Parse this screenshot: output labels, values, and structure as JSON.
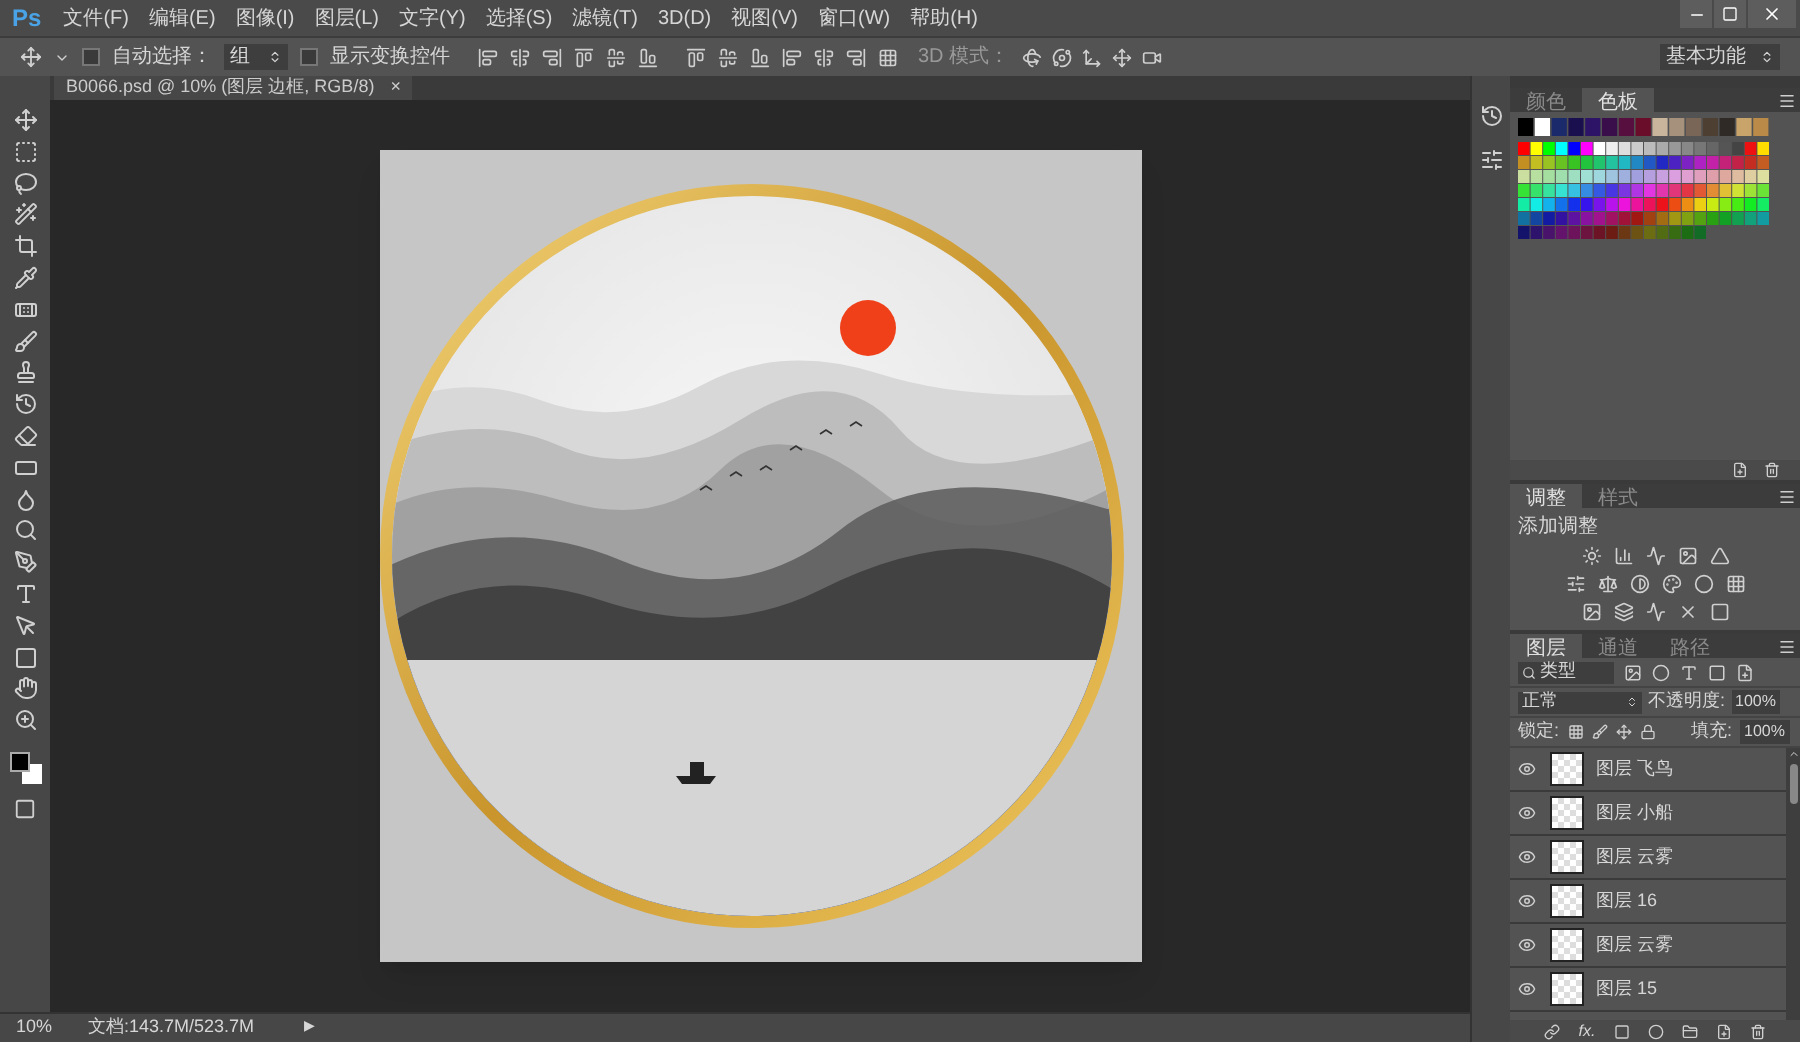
{
  "app_logo": "Ps",
  "menu": [
    "文件(F)",
    "编辑(E)",
    "图像(I)",
    "图层(L)",
    "文字(Y)",
    "选择(S)",
    "滤镜(T)",
    "3D(D)",
    "视图(V)",
    "窗口(W)",
    "帮助(H)"
  ],
  "options_bar": {
    "auto_select_checked": false,
    "auto_select_label": "自动选择：",
    "auto_select_value": "组",
    "show_transform_checked": false,
    "show_transform_label": "显示变换控件",
    "mode_3d_label": "3D 模式：",
    "workspace": "基本功能"
  },
  "document_tab": {
    "title": "B0066.psd @ 10% (图层 边框, RGB/8)",
    "close": "×"
  },
  "swatches_panel": {
    "tabs": [
      {
        "label": "颜色",
        "selected": false
      },
      {
        "label": "色板",
        "selected": true
      }
    ]
  },
  "adjustments_panel": {
    "tabs": [
      {
        "label": "调整",
        "selected": true
      },
      {
        "label": "样式",
        "selected": false
      }
    ],
    "heading": "添加调整"
  },
  "layers_panel": {
    "tabs": [
      {
        "label": "图层",
        "selected": true
      },
      {
        "label": "通道",
        "selected": false
      },
      {
        "label": "路径",
        "selected": false
      }
    ],
    "filter": "类型",
    "blend_mode": "正常",
    "opacity_label": "不透明度:",
    "opacity": "100%",
    "lock_label": "锁定:",
    "fill_label": "填充:",
    "fill": "100%",
    "fx": "fx.",
    "layers": [
      {
        "name": "图层 飞鸟",
        "visible": true
      },
      {
        "name": "图层 小船",
        "visible": true
      },
      {
        "name": "图层 云雾",
        "visible": true
      },
      {
        "name": "图层 16",
        "visible": true
      },
      {
        "name": "图层 云雾",
        "visible": true
      },
      {
        "name": "图层 15",
        "visible": true
      }
    ]
  },
  "status_bar": {
    "zoom": "10%",
    "doc_size": "文档:143.7M/523.7M",
    "arrow": "▶"
  }
}
